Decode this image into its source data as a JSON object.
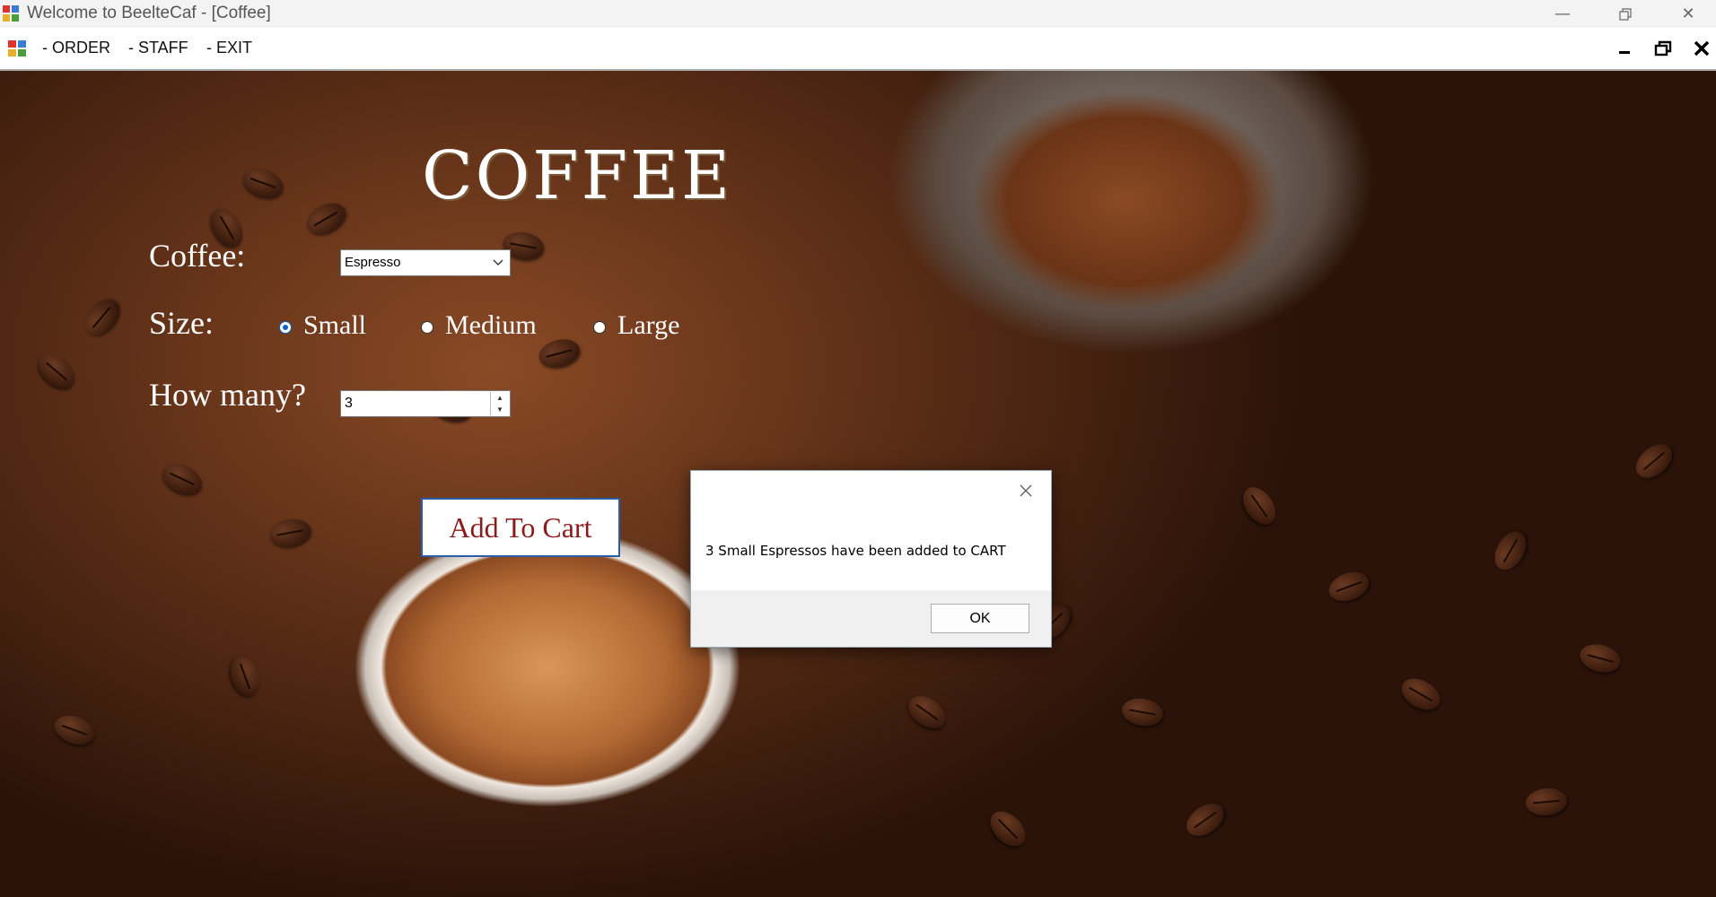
{
  "window": {
    "title": "Welcome to BeelteCaf - [Coffee]"
  },
  "menu": {
    "items": [
      "- ORDER",
      "- STAFF",
      "- EXIT"
    ]
  },
  "form": {
    "heading": "COFFEE",
    "coffee_label": "Coffee:",
    "coffee_selected": "Espresso",
    "size_label": "Size:",
    "size_options": [
      "Small",
      "Medium",
      "Large"
    ],
    "size_selected": "Small",
    "quantity_label": "How many?",
    "quantity_value": "3",
    "add_button": "Add To Cart"
  },
  "dialog": {
    "message": "3 Small Espressos have been added to CART",
    "ok_label": "OK"
  },
  "colors": {
    "titlebar": "#f3f3f3",
    "add_button_text": "#8b1a1a",
    "add_button_border": "#2a5fa8",
    "radio_selected": "#0b63c4"
  }
}
